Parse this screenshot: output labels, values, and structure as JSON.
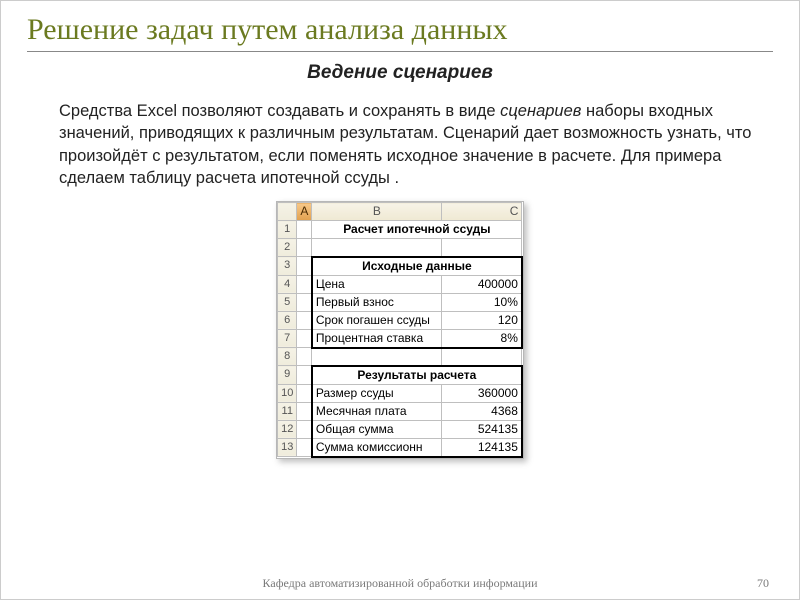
{
  "slide": {
    "title": "Решение задач путем анализа данных",
    "subtitle": "Ведение сценариев",
    "body_prefix": "Средства Excel позволяют создавать и сохранять в виде ",
    "body_em": "сценариев",
    "body_suffix": " наборы входных значений, приводящих к различным результатам. Сценарий дает возможность узнать, что произойдёт с результатом, если поменять исходное значение в расчете. Для примера сделаем таблицу расчета ипотечной ссуды ."
  },
  "excel": {
    "cols": {
      "A": "A",
      "B": "B",
      "C": "C"
    },
    "sheet_title": "Расчет ипотечной ссуды",
    "section1": "Исходные данные",
    "section2": "Результаты расчета",
    "rows_input": [
      {
        "label": "Цена",
        "value": "400000"
      },
      {
        "label": "Первый взнос",
        "value": "10%"
      },
      {
        "label": "Срок погашен ссуды",
        "value": "120"
      },
      {
        "label": "Процентная ставка",
        "value": "8%"
      }
    ],
    "rows_output": [
      {
        "label": "Размер ссуды",
        "value": "360000"
      },
      {
        "label": "Месячная плата",
        "value": "4368"
      },
      {
        "label": "Общая сумма",
        "value": "524135"
      },
      {
        "label": "Сумма  комиссионн",
        "value": "124135"
      }
    ],
    "rownums": [
      "1",
      "2",
      "3",
      "4",
      "5",
      "6",
      "7",
      "8",
      "9",
      "10",
      "11",
      "12",
      "13"
    ]
  },
  "footer": {
    "dept": "Кафедра автоматизированной обработки информации",
    "page": "70"
  }
}
